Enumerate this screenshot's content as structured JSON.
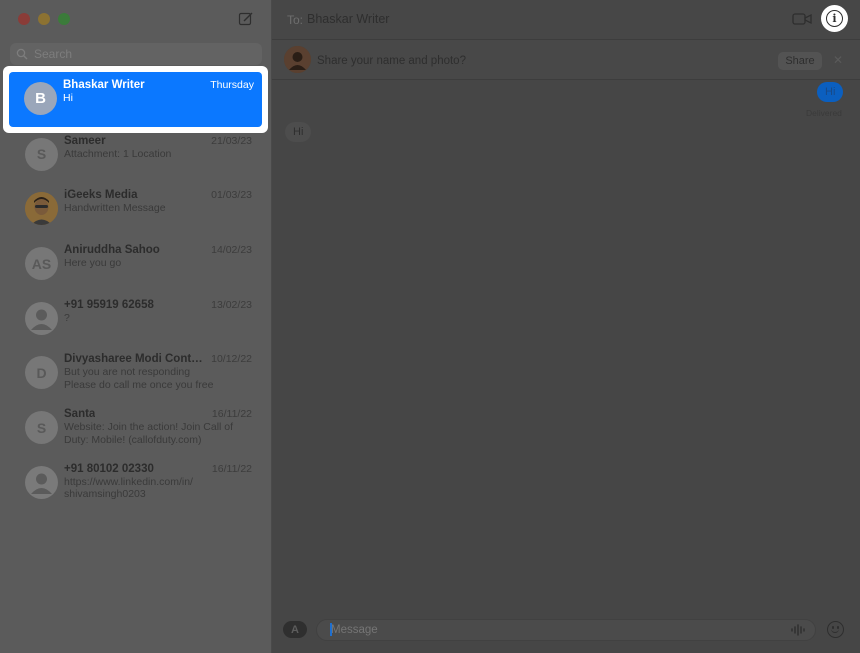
{
  "sidebar": {
    "search_placeholder": "Search",
    "conversations": [
      {
        "name": "Bhaskar Writer",
        "date": "Thursday",
        "preview": "Hi",
        "avatar": "B",
        "selected": true
      },
      {
        "name": "Sameer",
        "date": "21/03/23",
        "preview": "Attachment: 1 Location",
        "avatar": "S"
      },
      {
        "name": "iGeeks Media",
        "date": "01/03/23",
        "preview": "Handwritten Message",
        "avatar_icon": "memoji-avatar-icon"
      },
      {
        "name": "Aniruddha Sahoo",
        "date": "14/02/23",
        "preview": "Here you go",
        "avatar": "AS"
      },
      {
        "name": "+91 95919 62658",
        "date": "13/02/23",
        "preview": "?",
        "avatar_icon": "person-icon"
      },
      {
        "name": "Divyasharee Modi Conten...",
        "date": "10/12/22",
        "preview": "But you are not responding\nPlease do call me once you free",
        "avatar": "D"
      },
      {
        "name": "Santa",
        "date": "16/11/22",
        "preview": "Website: Join the action! Join Call of\nDuty: Mobile! (callofduty.com)",
        "avatar": "S"
      },
      {
        "name": "+91 80102 02330",
        "date": "16/11/22",
        "preview": "https://www.linkedin.com/in/\nshivamsingh0203",
        "avatar_icon": "person-icon"
      }
    ]
  },
  "header": {
    "to_label": "To:",
    "recipient": "Bhaskar Writer"
  },
  "share_banner": {
    "text": "Share your name and photo?",
    "button": "Share",
    "close": "✕"
  },
  "messages": {
    "outgoing": {
      "text": "Hi",
      "status": "Delivered"
    },
    "incoming": {
      "text": "Hi"
    }
  },
  "input": {
    "placeholder": "Message",
    "apps_label": "A"
  },
  "colors": {
    "selection": "#0b78ff",
    "info_highlight": "#ffffff"
  }
}
